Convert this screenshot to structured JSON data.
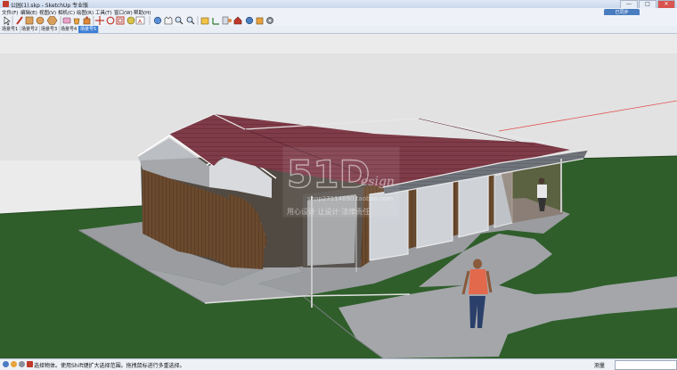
{
  "window": {
    "title": "公园(1).skp - SketchUp 专业版",
    "buttons": {
      "minimize": "—",
      "maximize": "□",
      "close": "✕"
    }
  },
  "menu": [
    "文件(F)",
    "编辑(E)",
    "视图(V)",
    "相机(C)",
    "绘图(R)",
    "工具(T)",
    "窗口(W)",
    "帮助(H)"
  ],
  "toolbar": {
    "icons": [
      "select-icon",
      "pencil-icon",
      "rectangle-icon",
      "circle-icon",
      "polygon-icon",
      "eraser-icon",
      "paint-bucket-icon",
      "push-pull-icon",
      "move-icon",
      "rotate-icon",
      "offset-icon",
      "orbit-icon",
      "pan-icon",
      "zoom-icon",
      "zoom-extents-icon",
      "tape-measure-icon",
      "text-icon",
      "axes-icon",
      "section-plane-icon",
      "warehouse-icon",
      "extension-icon",
      "component-icon"
    ],
    "sync_label": "已同步"
  },
  "scenes": [
    "场景号1",
    "场景号2",
    "场景号3",
    "场景号4",
    "场景号5"
  ],
  "active_scene": 4,
  "watermark": {
    "logo": "51D",
    "logo_sub": "esign",
    "shop": "shop27114690.taobao.com",
    "text": "用心设计 让设计·法律责任"
  },
  "status": {
    "hint": "选择物体。使用Shift键扩大选择范围。拖拽鼠标进行多重选择。",
    "measure_label": "测量",
    "measure_value": ""
  },
  "colors": {
    "accent": "#3c7fd6",
    "sky": "#e8e8e8",
    "grass": "#2f5e2a",
    "roof": "#7d3a45"
  }
}
